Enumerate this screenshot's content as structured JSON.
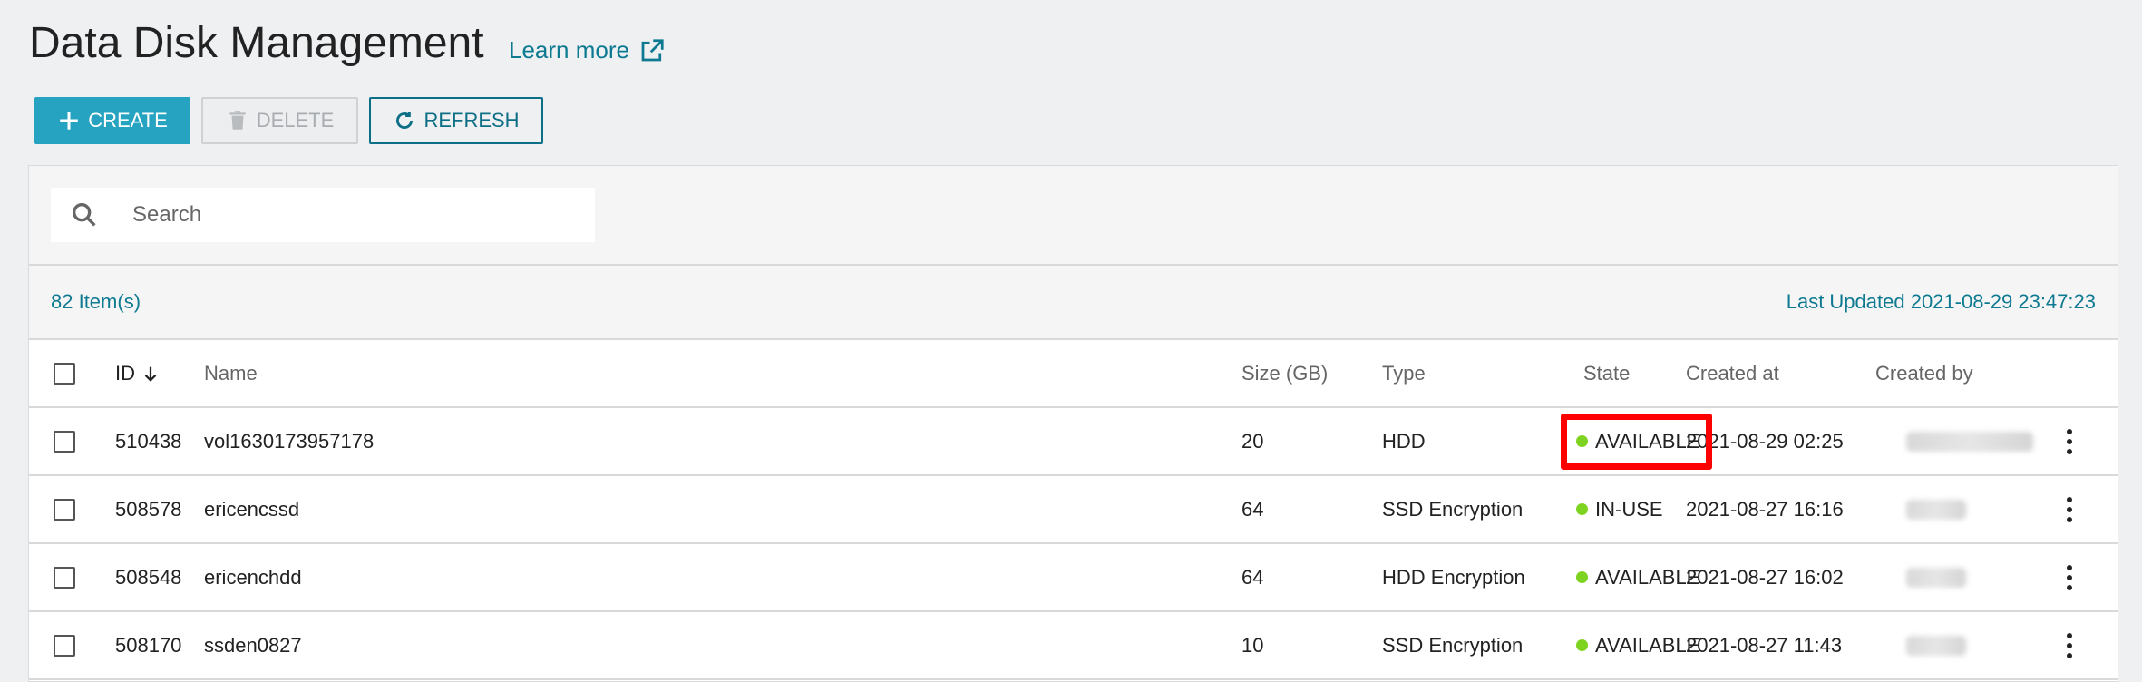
{
  "header": {
    "title": "Data Disk Management",
    "learn_more": "Learn more"
  },
  "toolbar": {
    "create_label": "CREATE",
    "delete_label": "DELETE",
    "refresh_label": "REFRESH"
  },
  "search": {
    "placeholder": "Search"
  },
  "info": {
    "item_count": "82 Item(s)",
    "last_updated": "Last Updated 2021-08-29 23:47:23"
  },
  "table": {
    "columns": {
      "id": "ID",
      "name": "Name",
      "size": "Size (GB)",
      "type": "Type",
      "state": "State",
      "created_at": "Created at",
      "created_by": "Created by"
    },
    "rows": [
      {
        "id": "510438",
        "name": "vol1630173957178",
        "size": "20",
        "type": "HDD",
        "state": "AVAILABLE",
        "created_at": "2021-08-29 02:25"
      },
      {
        "id": "508578",
        "name": "ericencssd",
        "size": "64",
        "type": "SSD Encryption",
        "state": "IN-USE",
        "created_at": "2021-08-27 16:16"
      },
      {
        "id": "508548",
        "name": "ericenchdd",
        "size": "64",
        "type": "HDD Encryption",
        "state": "AVAILABLE",
        "created_at": "2021-08-27 16:02"
      },
      {
        "id": "508170",
        "name": "ssden0827",
        "size": "10",
        "type": "SSD Encryption",
        "state": "AVAILABLE",
        "created_at": "2021-08-27 11:43"
      }
    ]
  },
  "colors": {
    "accent": "#26a3c0",
    "link": "#0d7a92",
    "status_ok": "#7ed321",
    "highlight": "#ff0000"
  },
  "icons": {
    "external_link": "external-link-icon",
    "create": "plus-icon",
    "delete": "trash-icon",
    "refresh": "refresh-icon",
    "search": "search-icon",
    "sort": "arrow-down-icon",
    "row_menu": "kebab-menu-icon"
  }
}
